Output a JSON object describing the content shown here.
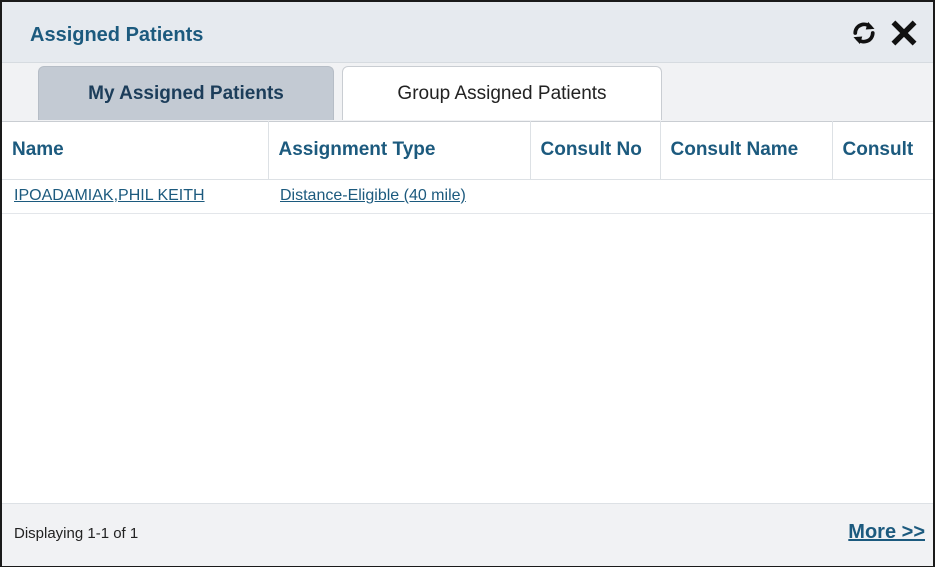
{
  "panel": {
    "title": "Assigned Patients",
    "icons": [
      "refresh-icon",
      "close-icon"
    ]
  },
  "tabs": [
    {
      "label": "My Assigned Patients",
      "active": true
    },
    {
      "label": "Group Assigned Patients",
      "active": false
    }
  ],
  "table": {
    "columns": [
      "Name",
      "Assignment Type",
      "Consult No",
      "Consult Name",
      "Consult"
    ],
    "rows": [
      {
        "name": "IPOADAMIAK,PHIL KEITH",
        "assignment_type": "Distance-Eligible (40 mile)",
        "consult_no": "",
        "consult_name": "",
        "consult": ""
      }
    ]
  },
  "footer": {
    "status": "Displaying 1-1 of 1",
    "more_label": "More >>"
  },
  "colors": {
    "accent": "#1c5a7e",
    "header_bg": "#e6eaef",
    "active_tab_bg": "#c3cad3"
  }
}
